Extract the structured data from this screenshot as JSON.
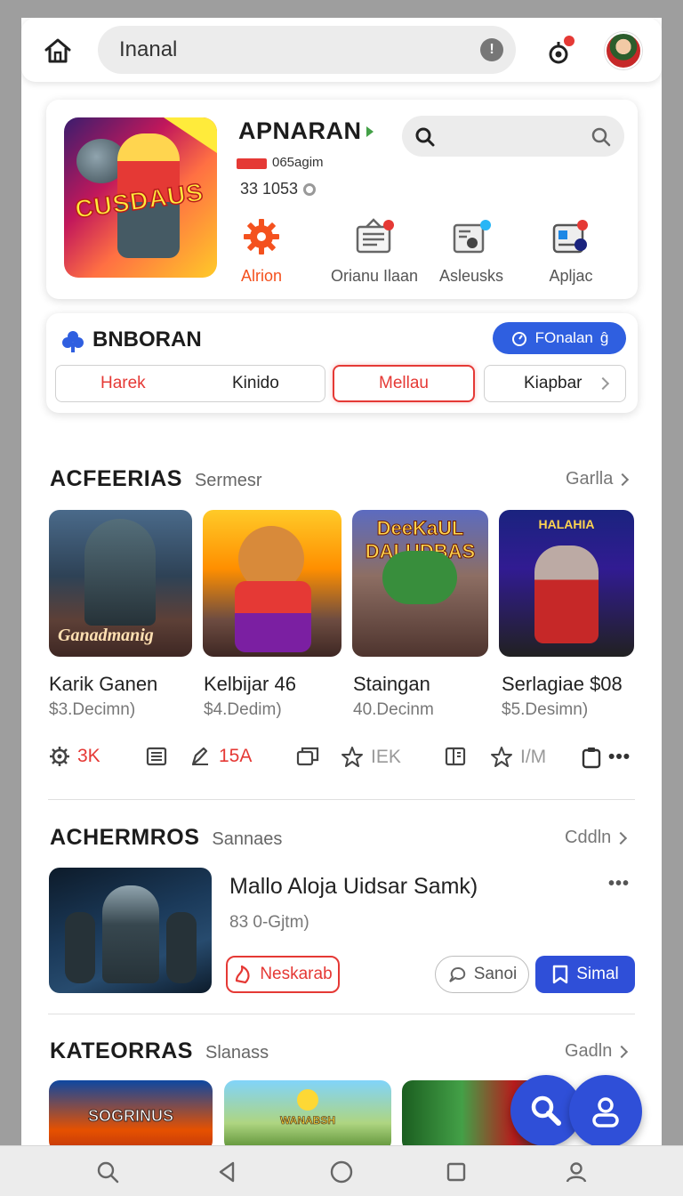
{
  "topbar": {
    "search_value": "Inanal",
    "info_glyph": "!"
  },
  "featured": {
    "art_text": "CUSDAUS",
    "title": "APNARAN",
    "meta_line": "065agim",
    "meta_line2": "33  1053",
    "actions": [
      {
        "label": "Alrion",
        "icon": "gear-icon",
        "active": true
      },
      {
        "label": "Orianu Ilaan",
        "icon": "newspaper-icon",
        "active": false
      },
      {
        "label": "Asleusks",
        "icon": "radio-icon",
        "active": false
      },
      {
        "label": "Apljac",
        "icon": "id-card-icon",
        "active": false
      }
    ]
  },
  "filter_card": {
    "title": "BNBORAN",
    "pill_label": "FOnalan",
    "pill_suffix": "ĝ",
    "tabs": [
      "Harek",
      "Kinido",
      "Mellau",
      "Kiapbar"
    ]
  },
  "section1": {
    "title": "ACFEERIAS",
    "subtitle": "Sermesr",
    "more": "Garlla",
    "items": [
      {
        "name": "Karik Ganen",
        "price": "$3.Decimn)",
        "art_text": "Ganadmanig"
      },
      {
        "name": "Kelbijar 46",
        "price": "$4.Dedim)",
        "art_text": ""
      },
      {
        "name": "Staingan",
        "price": "40.Decinm",
        "art_text": "DeeKaUL DALUDBAS"
      },
      {
        "name": "Serlagiae $08",
        "price": "$5.Desimn)",
        "art_text": "HALAHIA"
      }
    ],
    "stats": [
      {
        "icon": "gear-icon",
        "value": "3K",
        "accent": true
      },
      {
        "icon": "list-icon",
        "value": "",
        "accent": false
      },
      {
        "icon": "pen-icon",
        "value": "15A",
        "accent": true
      },
      {
        "icon": "copy-icon",
        "value": "",
        "accent": false
      },
      {
        "icon": "star-icon",
        "value": "IEK",
        "accent": false
      },
      {
        "icon": "book-icon",
        "value": "",
        "accent": false
      },
      {
        "icon": "star-icon",
        "value": "I/M",
        "accent": false
      },
      {
        "icon": "clipboard-icon",
        "value": "",
        "accent": false
      },
      {
        "icon": "more-icon",
        "value": "•••",
        "accent": false
      }
    ]
  },
  "section2": {
    "title": "ACHERMROS",
    "subtitle": "Sannaes",
    "more": "Cddln",
    "item": {
      "title": "Mallo Aloja Uidsar Samk)",
      "price": "83 0-Gjtm)",
      "menu": "•••",
      "btn_left": "Neskarab",
      "btn_mid": "Sanoi",
      "btn_right": "Simal"
    }
  },
  "section3": {
    "title": "KATEORRAS",
    "subtitle": "Slanass",
    "more": "Gadln",
    "items": [
      {
        "art_text": "SOGRINUS"
      },
      {
        "art_text": "WANABSH"
      },
      {
        "art_text": ""
      }
    ]
  },
  "colors": {
    "accent_red": "#e53935",
    "accent_orange": "#f4511e",
    "brand_blue": "#2f5fe0",
    "fab_blue": "#2f4fd8"
  }
}
